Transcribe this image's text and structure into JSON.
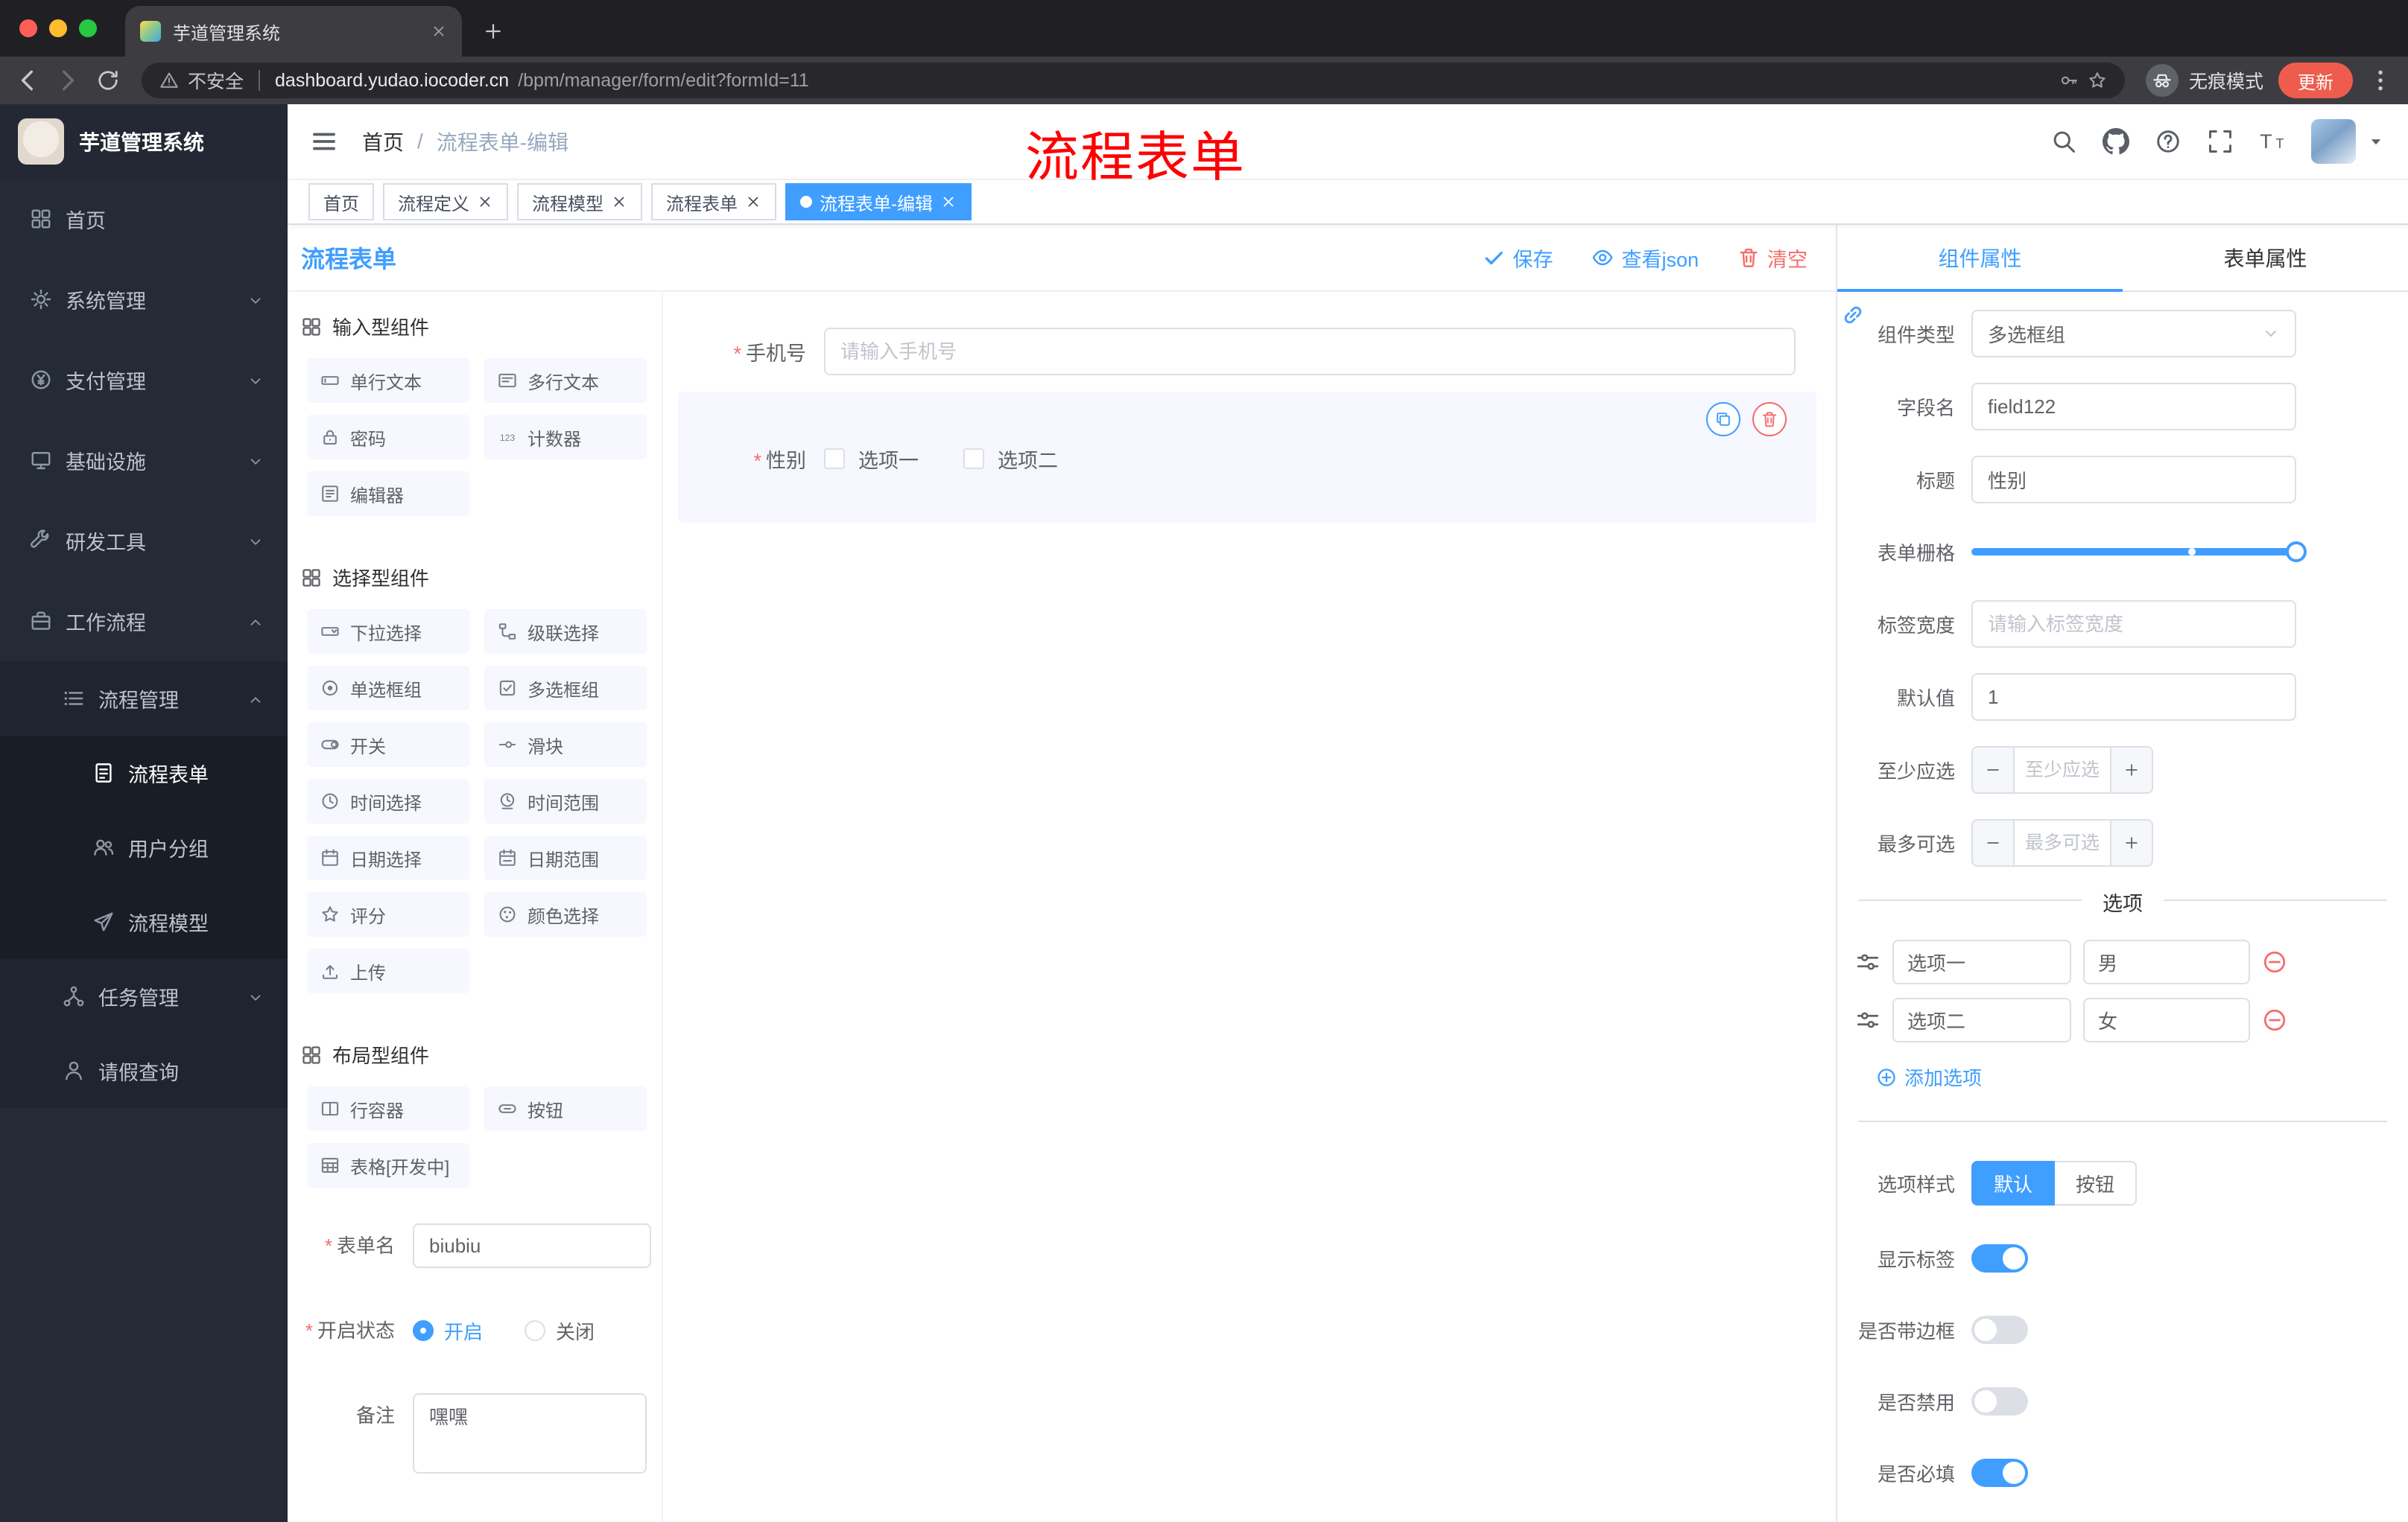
{
  "browser": {
    "tab_title": "芋道管理系统",
    "security_label": "不安全",
    "url_host": "dashboard.yudao.iocoder.cn",
    "url_path": "/bpm/manager/form/edit?formId=11",
    "incognito_label": "无痕模式",
    "update_label": "更新"
  },
  "annotation": {
    "text": "流程表单",
    "color": "#FF0000"
  },
  "sidebar": {
    "logo_title": "芋道管理系统",
    "menu": [
      {
        "name": "sidebar-item-home",
        "label": "首页",
        "icon": "dashboard",
        "level": 1
      },
      {
        "name": "sidebar-item-system",
        "label": "系统管理",
        "icon": "gear",
        "level": 1,
        "arrow": "down"
      },
      {
        "name": "sidebar-item-payment",
        "label": "支付管理",
        "icon": "payment",
        "level": 1,
        "arrow": "down"
      },
      {
        "name": "sidebar-item-infra",
        "label": "基础设施",
        "icon": "infra",
        "level": 1,
        "arrow": "down"
      },
      {
        "name": "sidebar-item-devtools",
        "label": "研发工具",
        "icon": "tools",
        "level": 1,
        "arrow": "down"
      },
      {
        "name": "sidebar-item-workflow",
        "label": "工作流程",
        "icon": "workflow",
        "level": 1,
        "arrow": "up"
      },
      {
        "name": "sidebar-item-process-mgmt",
        "label": "流程管理",
        "icon": "process",
        "level": 2,
        "arrow": "up"
      },
      {
        "name": "sidebar-item-process-form",
        "label": "流程表单",
        "icon": "form",
        "level": 3,
        "active": true
      },
      {
        "name": "sidebar-item-user-group",
        "label": "用户分组",
        "icon": "group",
        "level": 3
      },
      {
        "name": "sidebar-item-process-model",
        "label": "流程模型",
        "icon": "model",
        "level": 3
      },
      {
        "name": "sidebar-item-task-mgmt",
        "label": "任务管理",
        "icon": "task",
        "level": 2,
        "arrow": "down"
      },
      {
        "name": "sidebar-item-leave-query",
        "label": "请假查询",
        "icon": "leave",
        "level": 2
      }
    ]
  },
  "navbar": {
    "breadcrumb_home": "首页",
    "breadcrumb_current": "流程表单-编辑"
  },
  "tags": [
    {
      "name": "tag-home",
      "label": "首页",
      "closable": false,
      "active": false
    },
    {
      "name": "tag-process-definition",
      "label": "流程定义",
      "closable": true,
      "active": false
    },
    {
      "name": "tag-process-model",
      "label": "流程模型",
      "closable": true,
      "active": false
    },
    {
      "name": "tag-process-form",
      "label": "流程表单",
      "closable": true,
      "active": false
    },
    {
      "name": "tag-process-form-edit",
      "label": "流程表单-编辑",
      "closable": true,
      "active": true
    }
  ],
  "designer": {
    "title": "流程表单",
    "actions": {
      "save": "保存",
      "view_json": "查看json",
      "clear": "清空"
    },
    "palette_groups": [
      {
        "title": "输入型组件",
        "items": [
          {
            "label": "单行文本",
            "icon": "input"
          },
          {
            "label": "多行文本",
            "icon": "textarea"
          },
          {
            "label": "密码",
            "icon": "password"
          },
          {
            "label": "计数器",
            "icon": "number"
          },
          {
            "label": "编辑器",
            "icon": "richtext"
          }
        ]
      },
      {
        "title": "选择型组件",
        "items": [
          {
            "label": "下拉选择",
            "icon": "select"
          },
          {
            "label": "级联选择",
            "icon": "cascader"
          },
          {
            "label": "单选框组",
            "icon": "radio"
          },
          {
            "label": "多选框组",
            "icon": "checkbox"
          },
          {
            "label": "开关",
            "icon": "switch"
          },
          {
            "label": "滑块",
            "icon": "slider"
          },
          {
            "label": "时间选择",
            "icon": "time"
          },
          {
            "label": "时间范围",
            "icon": "timerange"
          },
          {
            "label": "日期选择",
            "icon": "date"
          },
          {
            "label": "日期范围",
            "icon": "daterange"
          },
          {
            "label": "评分",
            "icon": "rate"
          },
          {
            "label": "颜色选择",
            "icon": "color"
          },
          {
            "label": "上传",
            "icon": "upload"
          }
        ]
      },
      {
        "title": "布局型组件",
        "items": [
          {
            "label": "行容器",
            "icon": "row"
          },
          {
            "label": "按钮",
            "icon": "button"
          },
          {
            "label": "表格[开发中]",
            "icon": "table"
          }
        ]
      }
    ],
    "form": {
      "name_label": "表单名",
      "name_value": "biubiu",
      "status_label": "开启状态",
      "status_on": "开启",
      "status_off": "关闭",
      "remark_label": "备注",
      "remark_value": "嘿嘿"
    },
    "canvas": {
      "phone_label": "手机号",
      "phone_placeholder": "请输入手机号",
      "gender_label": "性别",
      "gender_option1": "选项一",
      "gender_option2": "选项二"
    }
  },
  "props": {
    "tabs": [
      "组件属性",
      "表单属性"
    ],
    "rows": {
      "component_type": {
        "label": "组件类型",
        "value": "多选框组"
      },
      "field_name": {
        "label": "字段名",
        "value": "field122"
      },
      "title": {
        "label": "标题",
        "value": "性别"
      },
      "grid": {
        "label": "表单栅格"
      },
      "label_width": {
        "label": "标签宽度",
        "placeholder": "请输入标签宽度"
      },
      "default_value": {
        "label": "默认值",
        "value": "1"
      },
      "min_select": {
        "label": "至少应选",
        "placeholder": "至少应选"
      },
      "max_select": {
        "label": "最多可选",
        "placeholder": "最多可选"
      }
    },
    "options_divider": "选项",
    "options": [
      {
        "label": "选项一",
        "value": "男"
      },
      {
        "label": "选项二",
        "value": "女"
      }
    ],
    "add_option": "添加选项",
    "option_style": {
      "label": "选项样式",
      "choices": [
        "默认",
        "按钮"
      ],
      "selected": "默认"
    },
    "switches": [
      {
        "name": "switch-show-label",
        "label": "显示标签",
        "on": true
      },
      {
        "name": "switch-border",
        "label": "是否带边框",
        "on": false
      },
      {
        "name": "switch-disabled",
        "label": "是否禁用",
        "on": false
      },
      {
        "name": "switch-required",
        "label": "是否必填",
        "on": true
      }
    ]
  },
  "colors": {
    "primary": "#409EFF",
    "danger": "#F56C6C",
    "annotation": "#FF0000",
    "sidebar_bg": "#252B36",
    "active_tag": "#409EFF"
  }
}
